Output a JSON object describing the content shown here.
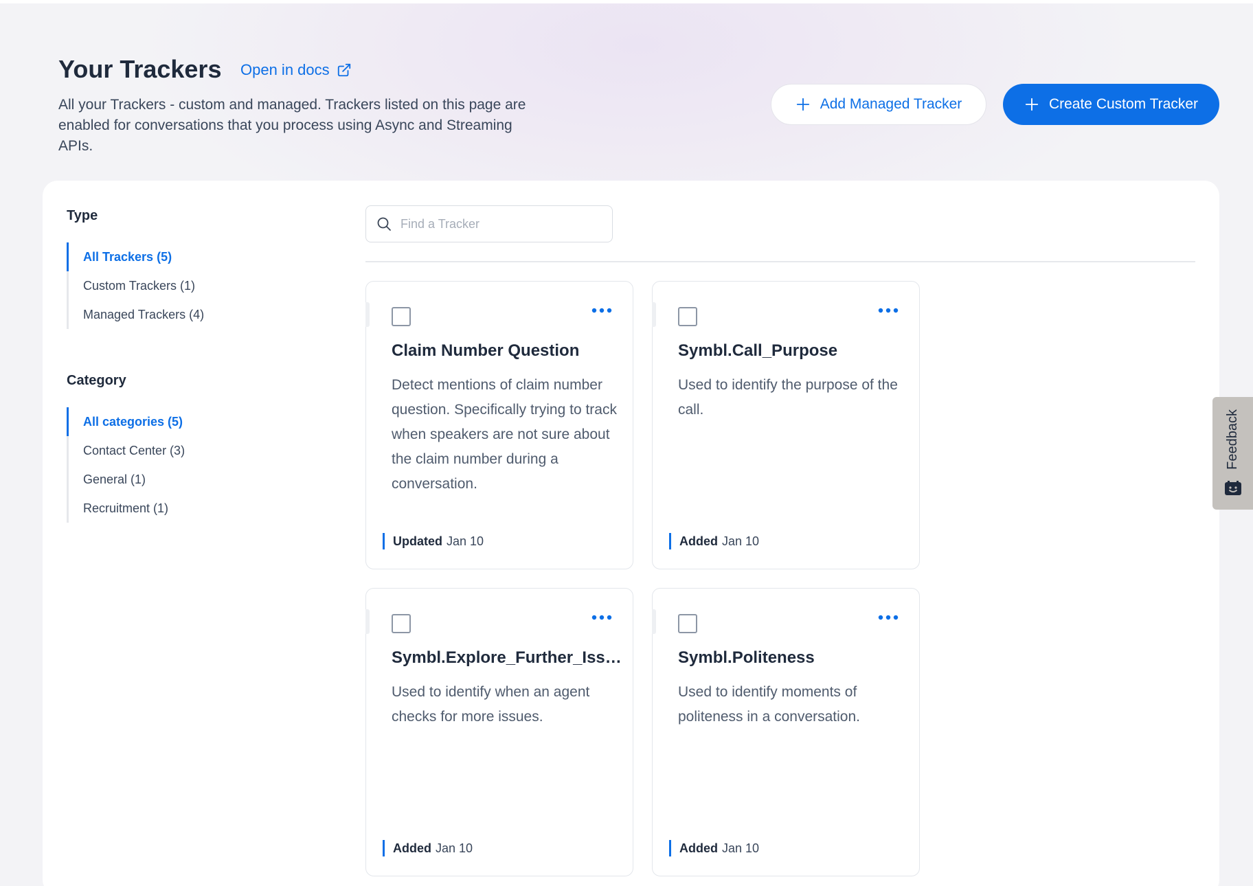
{
  "header": {
    "title": "Your Trackers",
    "docs_link": "Open in docs",
    "subtitle": "All your Trackers - custom and managed. Trackers listed on this page are enabled for conversations that you process using Async and Streaming APIs.",
    "add_managed_label": "Add Managed Tracker",
    "create_custom_label": "Create Custom Tracker"
  },
  "filters": {
    "type_heading": "Type",
    "type_items": [
      "All Trackers (5)",
      "Custom Trackers (1)",
      "Managed Trackers (4)"
    ],
    "category_heading": "Category",
    "category_items": [
      "All categories (5)",
      "Contact Center (3)",
      "General (1)",
      "Recruitment (1)"
    ]
  },
  "search": {
    "placeholder": "Find a Tracker"
  },
  "cards": [
    {
      "title": "Claim Number Question",
      "description": "Detect mentions of claim number question. Specifically trying to track when speakers are not sure about the claim number during a conversation.",
      "status": "Updated",
      "date": "Jan 10"
    },
    {
      "title": "Symbl.Call_Purpose",
      "description": "Used to identify the purpose of the call.",
      "status": "Added",
      "date": "Jan 10"
    },
    {
      "title": "Symbl.Explore_Further_Issues",
      "description": "Used to identify when an agent checks for more issues.",
      "status": "Added",
      "date": "Jan 10"
    },
    {
      "title": "Symbl.Politeness",
      "description": "Used to identify moments of politeness in a conversation.",
      "status": "Added",
      "date": "Jan 10"
    }
  ],
  "feedback": {
    "label": "Feedback"
  },
  "colors": {
    "accent": "#0d6fe6",
    "text": "#1f2a3c",
    "muted": "#4f5b6d",
    "panel": "#ffffff"
  },
  "icons": {
    "docs": "external-link-icon",
    "add": "plus-icon",
    "search": "search-icon",
    "more": "more-dots-icon",
    "feedback": "feedback-face-icon"
  }
}
